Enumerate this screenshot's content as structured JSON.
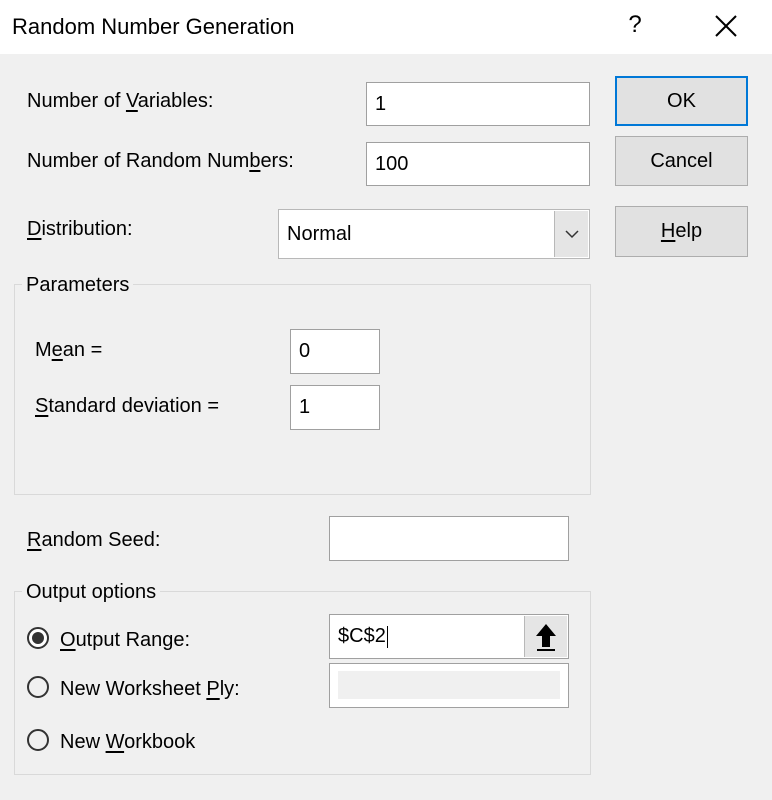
{
  "window": {
    "title": "Random Number Generation",
    "help_glyph": "?"
  },
  "fields": {
    "num_variables": {
      "label_pre": "Number of ",
      "label_key": "V",
      "label_post": "ariables:",
      "value": "1"
    },
    "num_random_numbers": {
      "label_pre": "Number of Random Num",
      "label_key": "b",
      "label_post": "ers:",
      "value": "100"
    },
    "distribution": {
      "label_key": "D",
      "label_post": "istribution:",
      "selected": "Normal"
    }
  },
  "parameters": {
    "legend": "Parameters",
    "mean": {
      "label_pre": "M",
      "label_key": "e",
      "label_post": "an =",
      "value": "0"
    },
    "std_dev": {
      "label_key": "S",
      "label_post": "tandard deviation =",
      "value": "1"
    }
  },
  "random_seed": {
    "label_key": "R",
    "label_post": "andom Seed:",
    "value": ""
  },
  "output_options": {
    "legend": "Output options",
    "output_range": {
      "label_key": "O",
      "label_post": "utput Range:",
      "value": "$C$2",
      "selected": true
    },
    "new_worksheet_ply": {
      "label_pre": "New Worksheet ",
      "label_key": "P",
      "label_post": "ly:",
      "value": "",
      "selected": false
    },
    "new_workbook": {
      "label_pre": "New ",
      "label_key": "W",
      "label_post": "orkbook",
      "selected": false
    }
  },
  "buttons": {
    "ok": "OK",
    "cancel": "Cancel",
    "help_key": "H",
    "help_post": "elp"
  },
  "colors": {
    "dialog_bg": "#f0f0f0",
    "default_button_border": "#0078d7"
  }
}
